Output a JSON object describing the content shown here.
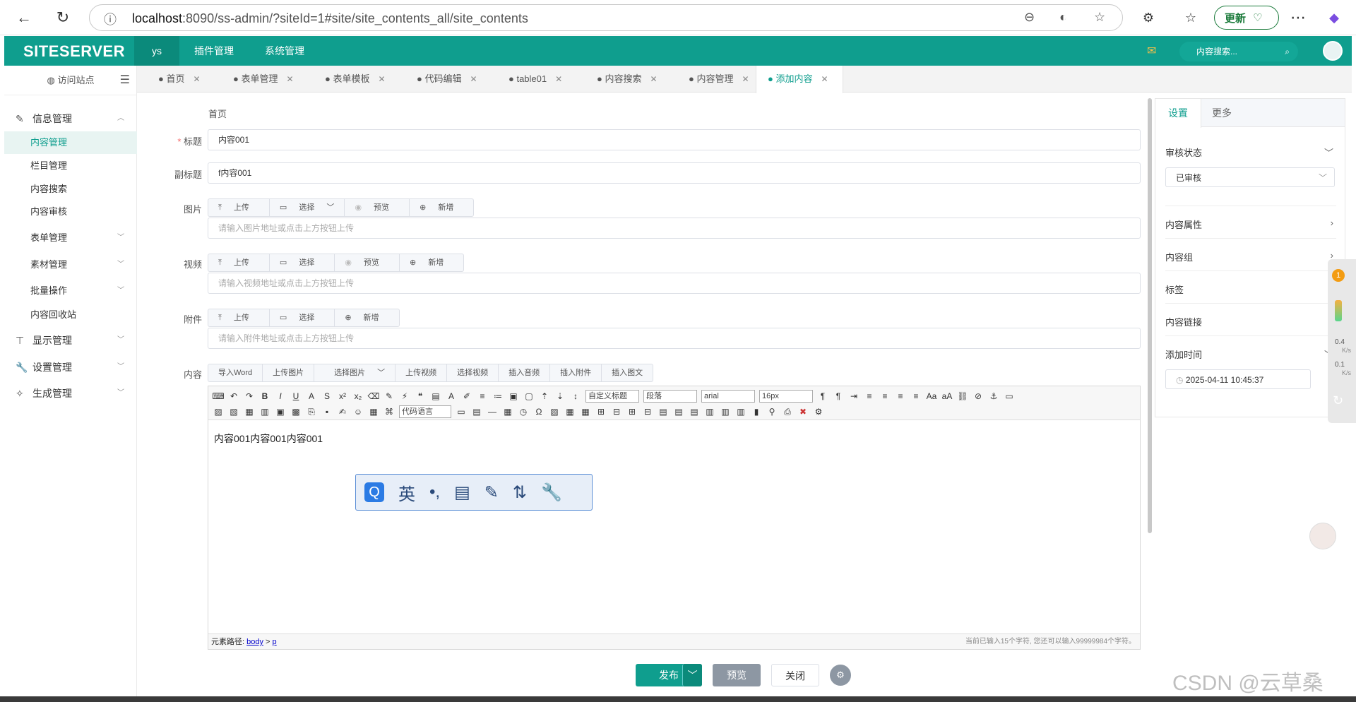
{
  "browser": {
    "url_host": "localhost",
    "url_rest": ":8090/ss-admin/?siteId=1#site/site_contents_all/site_contents",
    "update_label": "更新"
  },
  "app": {
    "logo": "SITESERVER",
    "nav": [
      "ys",
      "插件管理",
      "系统管理"
    ],
    "search_placeholder": "内容搜索..."
  },
  "sidebar": {
    "visit": "访问站点",
    "items": [
      {
        "label": "信息管理"
      },
      {
        "label": "内容管理"
      },
      {
        "label": "栏目管理"
      },
      {
        "label": "内容搜索"
      },
      {
        "label": "内容审核"
      },
      {
        "label": "表单管理"
      },
      {
        "label": "素材管理"
      },
      {
        "label": "批量操作"
      },
      {
        "label": "内容回收站"
      },
      {
        "label": "显示管理"
      },
      {
        "label": "设置管理"
      },
      {
        "label": "生成管理"
      }
    ]
  },
  "tabs": [
    "首页",
    "表单管理",
    "表单模板",
    "代码编辑",
    "table01",
    "内容搜索",
    "内容管理",
    "添加内容"
  ],
  "form": {
    "breadcrumb": "首页",
    "title_label": "标题",
    "title_value": "内容001",
    "subtitle_label": "副标题",
    "subtitle_value": "f内容001",
    "image_label": "图片",
    "video_label": "视频",
    "attach_label": "附件",
    "content_label": "内容",
    "btn_upload": "上传",
    "btn_select": "选择",
    "btn_preview": "预览",
    "btn_add": "新增",
    "image_placeholder": "请输入图片地址或点击上方按钮上传",
    "video_placeholder": "请输入视频地址或点击上方按钮上传",
    "attach_placeholder": "请输入附件地址或点击上方按钮上传",
    "content_tools": [
      "导入Word",
      "上传图片",
      "选择图片",
      "上传视频",
      "选择视频",
      "插入音频",
      "插入附件",
      "插入图文"
    ]
  },
  "editor": {
    "sel_title": "自定义标题",
    "sel_para": "段落",
    "sel_font": "arial",
    "sel_size": "16px",
    "sel_code": "代码语言",
    "body": "内容001内容001内容001",
    "path_label": "元素路径:",
    "path_body": "body",
    "path_p": "p",
    "count": "当前已输入15个字符, 您还可以输入99999984个字符。"
  },
  "ime": {
    "english": "英"
  },
  "panel": {
    "tab_settings": "设置",
    "tab_more": "更多",
    "audit_label": "审核状态",
    "audit_value": "已审核",
    "attr": "内容属性",
    "group": "内容组",
    "tag": "标签",
    "link": "内容链接",
    "addtime": "添加时间",
    "addtime_value": "2025-04-11 10:45:37"
  },
  "footer": {
    "publish": "发布",
    "preview": "预览",
    "close": "关闭"
  },
  "widget": {
    "badge": "1",
    "up": "0.4",
    "down": "0.1",
    "unit": "K/s"
  },
  "watermark": "CSDN @云草桑",
  "colors": {
    "brand": "#0f9e8e"
  }
}
